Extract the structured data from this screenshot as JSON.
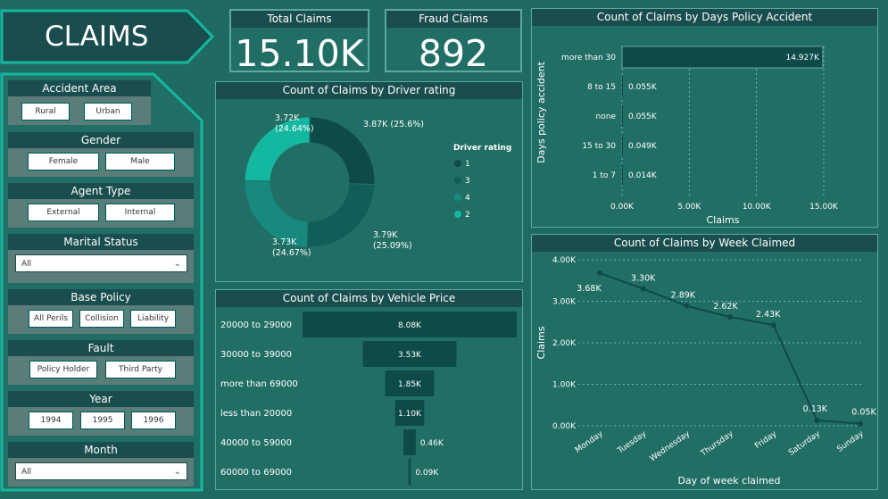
{
  "header": {
    "title": "CLAIMS"
  },
  "kpis": [
    {
      "label": "Total Claims",
      "value": "15.10K"
    },
    {
      "label": "Fraud Claims",
      "value": "892"
    }
  ],
  "filters": {
    "accident_area": {
      "title": "Accident Area",
      "options": [
        "Rural",
        "Urban"
      ]
    },
    "gender": {
      "title": "Gender",
      "options": [
        "Female",
        "Male"
      ]
    },
    "agent_type": {
      "title": "Agent Type",
      "options": [
        "External",
        "Internal"
      ]
    },
    "marital_status": {
      "title": "Marital Status",
      "selected": "All"
    },
    "base_policy": {
      "title": "Base Policy",
      "options": [
        "All Perils",
        "Collision",
        "Liability"
      ]
    },
    "fault": {
      "title": "Fault",
      "options": [
        "Policy Holder",
        "Third Party"
      ]
    },
    "year": {
      "title": "Year",
      "options": [
        "1994",
        "1995",
        "1996"
      ]
    },
    "month": {
      "title": "Month",
      "selected": "All"
    }
  },
  "colors": {
    "bg": "#1f6b62",
    "header": "#1a4d4d",
    "bar": "#0d4a47",
    "teal": "#14b8a0",
    "border": "#5aa99e"
  },
  "donut": {
    "title": "Count of Claims by Driver rating",
    "legend_title": "Driver rating",
    "slices": [
      {
        "name": "1",
        "label": "3.87K (25.6%)",
        "value": 25.6,
        "color": "#0e4b48"
      },
      {
        "name": "3",
        "label": "3.79K\n(25.09%)",
        "value": 25.09,
        "color": "#115e59"
      },
      {
        "name": "4",
        "label": "3.73K\n(24.67%)",
        "value": 24.67,
        "color": "#178a7d"
      },
      {
        "name": "2",
        "label": "3.72K\n(24.64%)",
        "value": 24.64,
        "color": "#14b8a0"
      }
    ]
  },
  "days_chart": {
    "title": "Count of Claims by Days Policy Accident",
    "ylabel": "Days policy accident",
    "xlabel": "Claims",
    "categories": [
      "more than 30",
      "8 to 15",
      "none",
      "15 to 30",
      "1 to 7"
    ],
    "values": [
      14.927,
      0.055,
      0.055,
      0.049,
      0.014
    ],
    "value_labels": [
      "14.927K",
      "0.055K",
      "0.055K",
      "0.049K",
      "0.014K"
    ],
    "xticks": [
      "0.00K",
      "5.00K",
      "10.00K",
      "15.00K"
    ],
    "xlim": [
      0,
      15
    ]
  },
  "vehicle_chart": {
    "title": "Count of Claims by Vehicle Price",
    "categories": [
      "20000 to 29000",
      "30000 to 39000",
      "more than 69000",
      "less than 20000",
      "40000 to 59000",
      "60000 to 69000"
    ],
    "values": [
      8.08,
      3.53,
      1.85,
      1.1,
      0.46,
      0.09
    ],
    "value_labels": [
      "8.08K",
      "3.53K",
      "1.85K",
      "1.10K",
      "0.46K",
      "0.09K"
    ]
  },
  "week_chart": {
    "title": "Count of Claims by Week Claimed",
    "ylabel": "Claims",
    "xlabel": "Day of week claimed",
    "categories": [
      "Monday",
      "Tuesday",
      "Wednesday",
      "Thursday",
      "Friday",
      "Saturday",
      "Sunday"
    ],
    "values": [
      3.68,
      3.3,
      2.89,
      2.62,
      2.43,
      0.13,
      0.05
    ],
    "value_labels": [
      "3.68K",
      "3.30K",
      "2.89K",
      "2.62K",
      "2.43K",
      "0.13K",
      "0.05K"
    ],
    "yticks": [
      "0.00K",
      "1.00K",
      "2.00K",
      "3.00K",
      "4.00K"
    ],
    "ylim": [
      0,
      4
    ]
  },
  "chart_data": [
    {
      "type": "pie",
      "title": "Count of Claims by Driver rating",
      "categories": [
        "1",
        "3",
        "4",
        "2"
      ],
      "values": [
        3870,
        3790,
        3730,
        3720
      ]
    },
    {
      "type": "bar",
      "title": "Count of Claims by Days Policy Accident",
      "xlabel": "Claims",
      "ylabel": "Days policy accident",
      "categories": [
        "more than 30",
        "8 to 15",
        "none",
        "15 to 30",
        "1 to 7"
      ],
      "values": [
        14927,
        55,
        55,
        49,
        14
      ],
      "xlim": [
        0,
        15000
      ]
    },
    {
      "type": "bar",
      "title": "Count of Claims by Vehicle Price",
      "categories": [
        "20000 to 29000",
        "30000 to 39000",
        "more than 69000",
        "less than 20000",
        "40000 to 59000",
        "60000 to 69000"
      ],
      "values": [
        8080,
        3530,
        1850,
        1100,
        460,
        90
      ]
    },
    {
      "type": "line",
      "title": "Count of Claims by Week Claimed",
      "xlabel": "Day of week claimed",
      "ylabel": "Claims",
      "categories": [
        "Monday",
        "Tuesday",
        "Wednesday",
        "Thursday",
        "Friday",
        "Saturday",
        "Sunday"
      ],
      "values": [
        3680,
        3300,
        2890,
        2620,
        2430,
        130,
        50
      ],
      "ylim": [
        0,
        4000
      ]
    }
  ]
}
